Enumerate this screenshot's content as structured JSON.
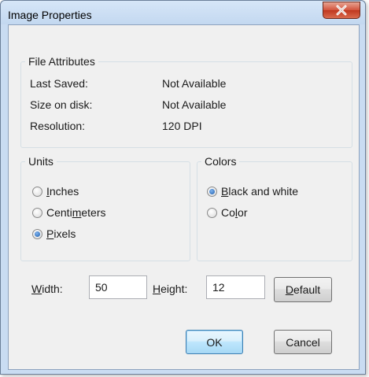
{
  "window": {
    "title": "Image Properties",
    "close_icon": "close-icon"
  },
  "file_attributes": {
    "legend": "File Attributes",
    "rows": [
      {
        "label": "Last Saved:",
        "value": "Not Available"
      },
      {
        "label": "Size on disk:",
        "value": "Not Available"
      },
      {
        "label": "Resolution:",
        "value": "120 DPI"
      }
    ]
  },
  "units": {
    "legend": "Units",
    "options": [
      {
        "pre": "",
        "key": "I",
        "post": "nches",
        "selected": false
      },
      {
        "pre": "Centi",
        "key": "m",
        "post": "eters",
        "selected": false
      },
      {
        "pre": "",
        "key": "P",
        "post": "ixels",
        "selected": true
      }
    ]
  },
  "colors": {
    "legend": "Colors",
    "options": [
      {
        "pre": "",
        "key": "B",
        "post": "lack and white",
        "selected": true
      },
      {
        "pre": "Co",
        "key": "l",
        "post": "or",
        "selected": false
      }
    ]
  },
  "size": {
    "width_label_key": "W",
    "width_label_rest": "idth:",
    "width_value": "50",
    "height_label_key": "H",
    "height_label_rest": "eight:",
    "height_value": "12"
  },
  "buttons": {
    "default_key": "D",
    "default_rest": "efault",
    "ok": "OK",
    "cancel": "Cancel"
  },
  "colors_theme": {
    "titlebar": "#c9dcf2",
    "close_button": "#c0371f",
    "dialog_bg": "#f0f0f0",
    "radio_selected": "#1f5fae"
  }
}
